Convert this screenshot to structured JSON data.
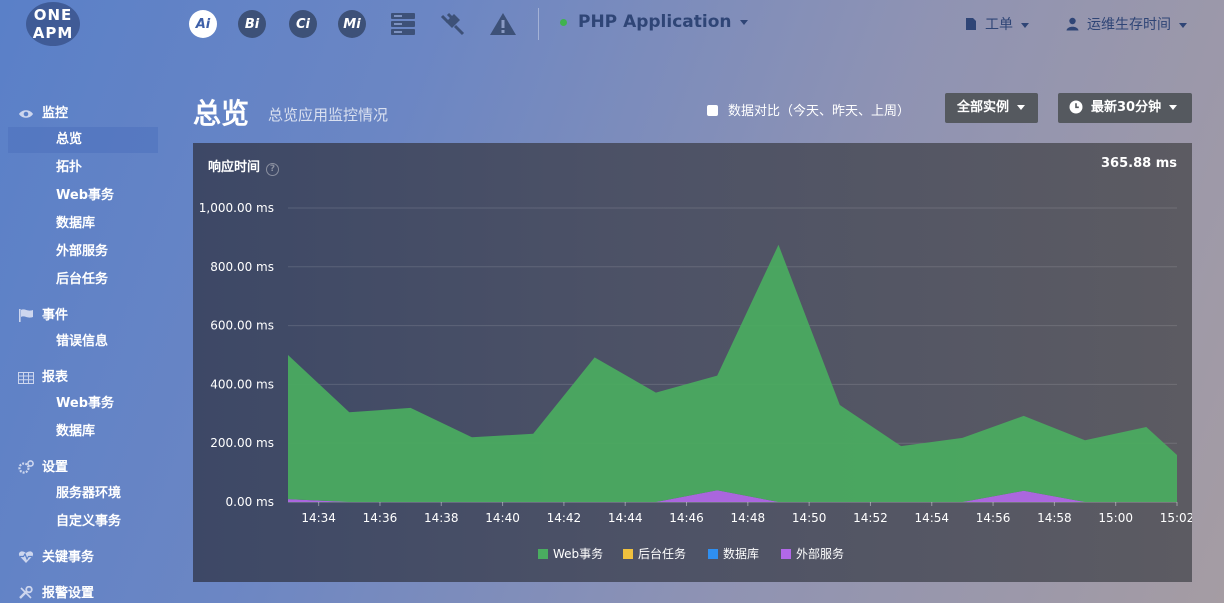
{
  "brand": {
    "line1": "ONE",
    "line2": "APM"
  },
  "products": [
    {
      "name": "ai-icon",
      "label": "Ai",
      "active": true
    },
    {
      "name": "bi-icon",
      "label": "Bi",
      "active": false
    },
    {
      "name": "ci-icon",
      "label": "Ci",
      "active": false
    },
    {
      "name": "mi-icon",
      "label": "Mi",
      "active": false
    }
  ],
  "topbar": {
    "app_name": "PHP Application",
    "app_status_color": "#3fb34f",
    "ticket_label": "工单",
    "user_label": "运维生存时间"
  },
  "sidebar": {
    "sections": [
      {
        "label": "监控",
        "icon": "eye-icon",
        "items": [
          "总览",
          "拓扑",
          "Web事务",
          "数据库",
          "外部服务",
          "后台任务"
        ]
      },
      {
        "label": "事件",
        "icon": "flag-icon",
        "items": [
          "错误信息"
        ]
      },
      {
        "label": "报表",
        "icon": "table-icon",
        "items": [
          "Web事务",
          "数据库"
        ]
      },
      {
        "label": "设置",
        "icon": "gears-icon",
        "items": [
          "服务器环境",
          "自定义事务"
        ]
      },
      {
        "label": "关键事务",
        "icon": "heart-pulse-icon",
        "items": []
      },
      {
        "label": "报警设置",
        "icon": "wrench-icon",
        "items": []
      }
    ],
    "active_item": "总览"
  },
  "header": {
    "title": "总览",
    "subtitle": "总览应用监控情况",
    "compare_label": "数据对比（今天、昨天、上周）",
    "instances_label": "全部实例",
    "time_label": "最新30分钟"
  },
  "panel": {
    "title": "响应时间",
    "current_value": "365.88 ms"
  },
  "chart_data": {
    "type": "area",
    "title": "响应时间",
    "stacked": true,
    "x": [
      "14:33",
      "14:35",
      "14:37",
      "14:39",
      "14:41",
      "14:43",
      "14:45",
      "14:47",
      "14:49",
      "14:51",
      "14:53",
      "14:55",
      "14:57",
      "14:59",
      "15:01",
      "15:02"
    ],
    "x_ticks": [
      "14:34",
      "14:36",
      "14:38",
      "14:40",
      "14:42",
      "14:44",
      "14:46",
      "14:48",
      "14:50",
      "14:52",
      "14:54",
      "14:56",
      "14:58",
      "15:00",
      "15:02"
    ],
    "y_ticks": [
      "0.00 ms",
      "200.00 ms",
      "400.00 ms",
      "600.00 ms",
      "800.00 ms",
      "1,000.00 ms"
    ],
    "ylim": [
      0,
      1000
    ],
    "series": [
      {
        "name": "外部服务",
        "color": "#b268e8",
        "values": [
          10,
          0,
          0,
          0,
          0,
          0,
          0,
          40,
          0,
          0,
          0,
          0,
          38,
          0,
          0,
          0
        ]
      },
      {
        "name": "数据库",
        "color": "#2f8ff0",
        "values": [
          0,
          0,
          0,
          0,
          0,
          0,
          0,
          0,
          0,
          0,
          0,
          0,
          0,
          0,
          0,
          0
        ]
      },
      {
        "name": "后台任务",
        "color": "#f0c13e",
        "values": [
          0,
          0,
          0,
          0,
          0,
          0,
          0,
          0,
          0,
          0,
          0,
          0,
          0,
          0,
          0,
          0
        ]
      },
      {
        "name": "Web事务",
        "color": "#4aad60",
        "values": [
          490,
          305,
          320,
          220,
          232,
          492,
          372,
          390,
          875,
          330,
          190,
          218,
          255,
          210,
          255,
          160
        ]
      }
    ],
    "legend": [
      {
        "name": "Web事务",
        "color": "#4aad60"
      },
      {
        "name": "后台任务",
        "color": "#f0c13e"
      },
      {
        "name": "数据库",
        "color": "#2f8ff0"
      },
      {
        "name": "外部服务",
        "color": "#b268e8"
      }
    ],
    "legend_position": "bottom",
    "grid": true
  }
}
